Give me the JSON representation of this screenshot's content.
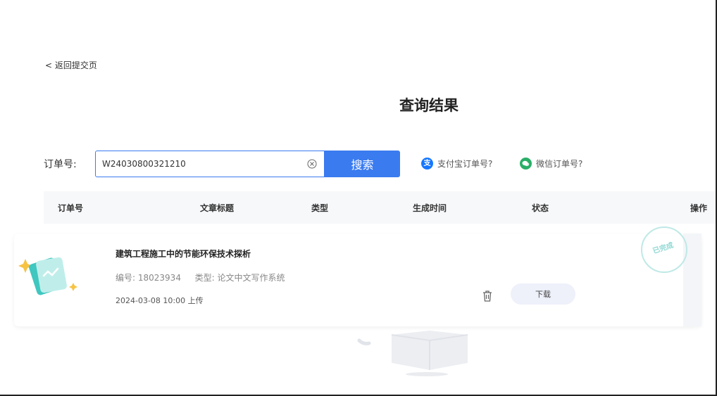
{
  "nav": {
    "back_label": "< 返回提交页"
  },
  "page": {
    "title": "查询结果"
  },
  "search": {
    "label": "订单号:",
    "value": "W24030800321210",
    "button_label": "搜索",
    "clear_icon": "clear-icon",
    "alipay_help": "支付宝订单号?",
    "wechat_help": "微信订单号?"
  },
  "table": {
    "columns": [
      "订单号",
      "文章标题",
      "类型",
      "生成时间",
      "状态",
      "操作"
    ]
  },
  "orders": [
    {
      "title": "建筑工程施工中的节能环保技术探析",
      "id_label": "编号:",
      "id": "18023934",
      "type_label": "类型:",
      "type": "论文中文写作系统",
      "time": "2024-03-08 10:00 上传",
      "status": "已完成",
      "download_label": "下载"
    }
  ],
  "colors": {
    "primary": "#3a7bf0",
    "alipay": "#1677ff",
    "wechat": "#2aae67",
    "stamp": "#8fd8d3"
  }
}
